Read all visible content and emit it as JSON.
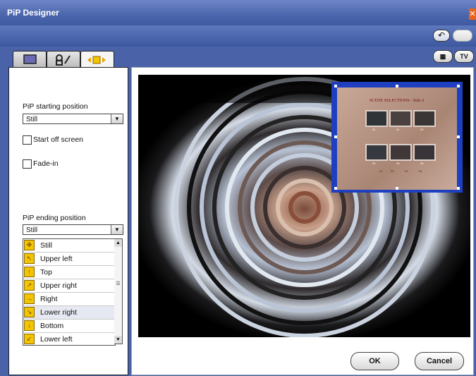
{
  "window": {
    "title": "PiP Designer",
    "close_glyph": "✕"
  },
  "toolbar": {
    "undo_icon": "undo-icon",
    "redo_icon": "redo-icon",
    "undo_glyph": "↶"
  },
  "view_buttons": {
    "grid_glyph": "▦",
    "tv_label": "TV"
  },
  "tabs": [
    {
      "name": "tab-display",
      "icon": "monitor-icon"
    },
    {
      "name": "tab-effects",
      "icon": "effects-icon"
    },
    {
      "name": "tab-motion",
      "icon": "motion-icon",
      "active": true
    }
  ],
  "start": {
    "label": "PiP starting position",
    "value": "Still",
    "offscreen_label": "Start off screen",
    "offscreen_checked": false,
    "fade_label": "Fade-in",
    "fade_checked": false
  },
  "end": {
    "label": "PiP ending position",
    "value": "Still",
    "options": [
      {
        "label": "Still",
        "glyph": "✥"
      },
      {
        "label": "Upper left",
        "glyph": "↖"
      },
      {
        "label": "Top",
        "glyph": "↑"
      },
      {
        "label": "Upper right",
        "glyph": "↗"
      },
      {
        "label": "Right",
        "glyph": "→"
      },
      {
        "label": "Lower right",
        "glyph": "↘",
        "selected": true
      },
      {
        "label": "Bottom",
        "glyph": "↓"
      },
      {
        "label": "Lower left",
        "glyph": "↙"
      }
    ]
  },
  "preview": {
    "pip_menu": {
      "title": "SCENE SELECTIONS - Side A",
      "thumb_labels": [
        "01",
        "02",
        "03",
        "04",
        "05",
        "06"
      ],
      "footer": [
        "01",
        "02",
        "03",
        "04"
      ]
    }
  },
  "buttons": {
    "ok": "OK",
    "cancel": "Cancel"
  },
  "colors": {
    "title_bar": "#4b66ad",
    "pip_selection": "#1e3fc0",
    "button_face": "#f2f2f2"
  }
}
